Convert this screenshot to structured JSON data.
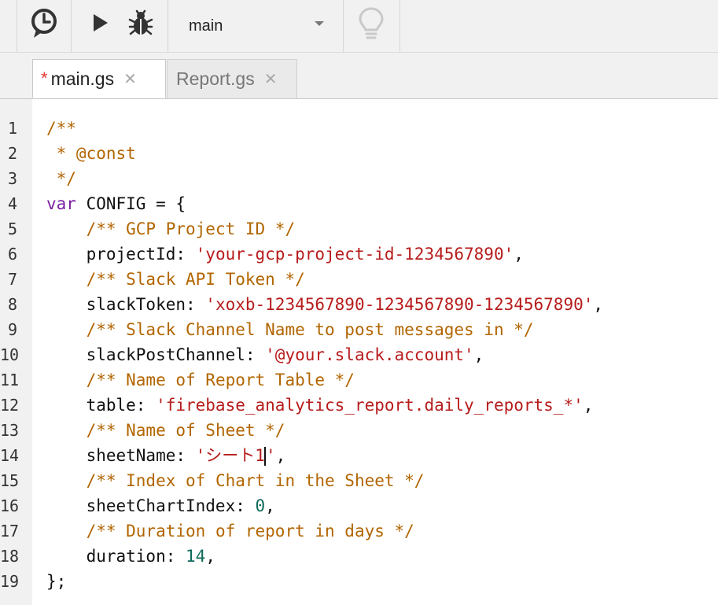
{
  "toolbar": {
    "icons": [
      "clock-icon",
      "run-icon",
      "debug-bug-icon",
      "lightbulb-icon"
    ],
    "function_select": "main"
  },
  "tabs": [
    {
      "label": "main.gs",
      "modified": "*",
      "close": "✕"
    },
    {
      "label": "Report.gs",
      "close": "✕"
    }
  ],
  "editor": {
    "line_numbers": [
      "1",
      "2",
      "3",
      "4",
      "5",
      "6",
      "7",
      "8",
      "9",
      "10",
      "11",
      "12",
      "13",
      "14",
      "15",
      "16",
      "17",
      "18",
      "19"
    ],
    "lines": [
      [
        {
          "t": "/**",
          "c": "cm"
        }
      ],
      [
        {
          "t": " * @const",
          "c": "cm"
        }
      ],
      [
        {
          "t": " */",
          "c": "cm"
        }
      ],
      [
        {
          "t": "var",
          "c": "kw"
        },
        {
          "t": " CONFIG = {",
          "c": ""
        }
      ],
      [
        {
          "t": "    ",
          "c": ""
        },
        {
          "t": "/** GCP Project ID */",
          "c": "cm"
        }
      ],
      [
        {
          "t": "    projectId: ",
          "c": ""
        },
        {
          "t": "'your-gcp-project-id-1234567890'",
          "c": "str"
        },
        {
          "t": ",",
          "c": ""
        }
      ],
      [
        {
          "t": "    ",
          "c": ""
        },
        {
          "t": "/** Slack API Token */",
          "c": "cm"
        }
      ],
      [
        {
          "t": "    slackToken: ",
          "c": ""
        },
        {
          "t": "'xoxb-1234567890-1234567890-1234567890'",
          "c": "str"
        },
        {
          "t": ",",
          "c": ""
        }
      ],
      [
        {
          "t": "    ",
          "c": ""
        },
        {
          "t": "/** Slack Channel Name to post messages in */",
          "c": "cm"
        }
      ],
      [
        {
          "t": "    slackPostChannel: ",
          "c": ""
        },
        {
          "t": "'@your.slack.account'",
          "c": "str"
        },
        {
          "t": ",",
          "c": ""
        }
      ],
      [
        {
          "t": "    ",
          "c": ""
        },
        {
          "t": "/** Name of Report Table */",
          "c": "cm"
        }
      ],
      [
        {
          "t": "    table: ",
          "c": ""
        },
        {
          "t": "'firebase_analytics_report.daily_reports_*'",
          "c": "str"
        },
        {
          "t": ",",
          "c": ""
        }
      ],
      [
        {
          "t": "    ",
          "c": ""
        },
        {
          "t": "/** Name of Sheet */",
          "c": "cm"
        }
      ],
      [
        {
          "t": "    sheetName: ",
          "c": ""
        },
        {
          "t": "'シート1",
          "c": "str"
        },
        {
          "t": "|",
          "c": "cursor"
        },
        {
          "t": "'",
          "c": "str"
        },
        {
          "t": ",",
          "c": ""
        }
      ],
      [
        {
          "t": "    ",
          "c": ""
        },
        {
          "t": "/** Index of Chart in the Sheet */",
          "c": "cm"
        }
      ],
      [
        {
          "t": "    sheetChartIndex: ",
          "c": ""
        },
        {
          "t": "0",
          "c": "num"
        },
        {
          "t": ",",
          "c": ""
        }
      ],
      [
        {
          "t": "    ",
          "c": ""
        },
        {
          "t": "/** Duration of report in days */",
          "c": "cm"
        }
      ],
      [
        {
          "t": "    duration: ",
          "c": ""
        },
        {
          "t": "14",
          "c": "num"
        },
        {
          "t": ",",
          "c": ""
        }
      ],
      [
        {
          "t": "};",
          "c": ""
        }
      ]
    ]
  }
}
